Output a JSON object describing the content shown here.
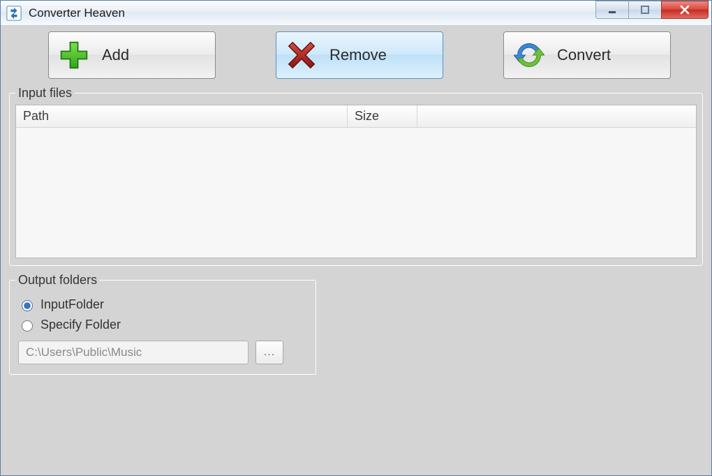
{
  "window": {
    "title": "Converter Heaven"
  },
  "toolbar": {
    "add_label": "Add",
    "remove_label": "Remove",
    "convert_label": "Convert"
  },
  "input_group": {
    "legend": "Input files",
    "columns": {
      "path": "Path",
      "size": "Size"
    },
    "rows": []
  },
  "output_group": {
    "legend": "Output folders",
    "radio_input_folder": "InputFolder",
    "radio_specify": "Specify Folder",
    "selected": "InputFolder",
    "path_value": "C:\\Users\\Public\\Music",
    "browse_label": "..."
  }
}
